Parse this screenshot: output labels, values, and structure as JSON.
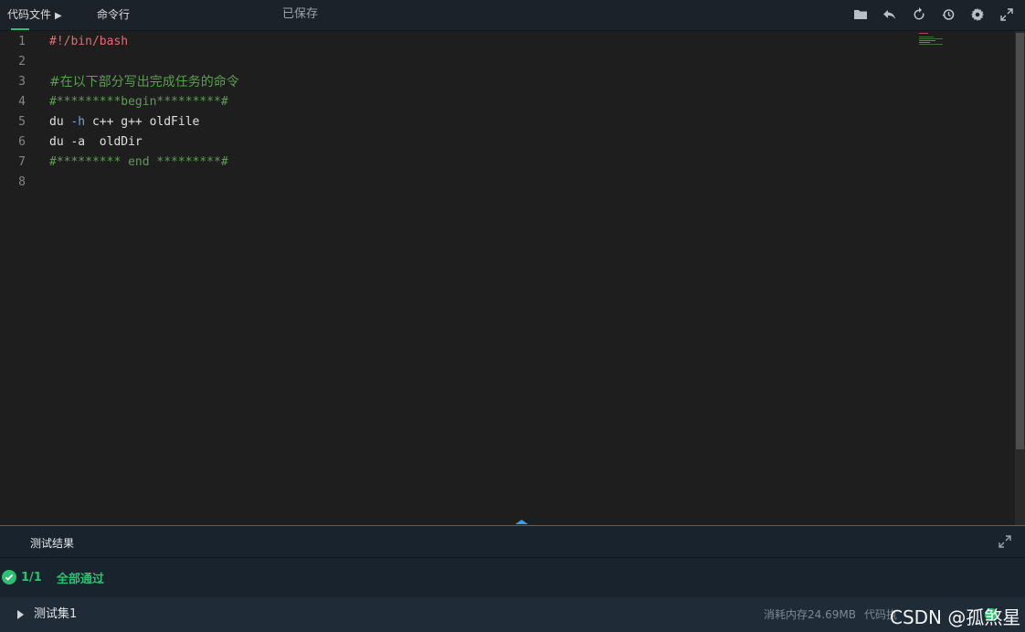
{
  "toolbar": {
    "code_files_tab": "代码文件",
    "command_line_tab": "命令行",
    "save_status": "已保存",
    "icons": [
      "folder-icon",
      "undo-icon",
      "refresh-icon",
      "history-icon",
      "gear-icon",
      "fullscreen-icon"
    ]
  },
  "editor": {
    "line_numbers": [
      "1",
      "2",
      "3",
      "4",
      "5",
      "6",
      "7",
      "8"
    ],
    "lines": [
      {
        "text": "#!/bin/bash",
        "kind": "shebang"
      },
      {
        "text": "",
        "kind": "plain"
      },
      {
        "text": "#在以下部分写出完成任务的命令",
        "kind": "comment"
      },
      {
        "text": "#*********begin*********#",
        "kind": "comment"
      },
      {
        "cmd": "du",
        "flag": "-h",
        "rest": "c++ g++ oldFile",
        "kind": "command"
      },
      {
        "cmd": "du",
        "flag": "-a",
        "rest": " oldDir",
        "kind": "command"
      },
      {
        "text": "#********* end *********#",
        "kind": "comment"
      },
      {
        "text": "",
        "kind": "plain"
      }
    ],
    "colors": {
      "comment": "#5c9e52",
      "shebang": "#e06c75",
      "flag": "#6aa6e8"
    }
  },
  "panel": {
    "title": "测试结果",
    "result_count": "1/1",
    "result_message": "全部通过",
    "result_color": "#2fbf71",
    "test_set": {
      "name": "测试集1",
      "memory": "消耗内存24.69MB",
      "code_stat": "代码执"
    }
  },
  "watermark": "CSDN @孤煞星"
}
